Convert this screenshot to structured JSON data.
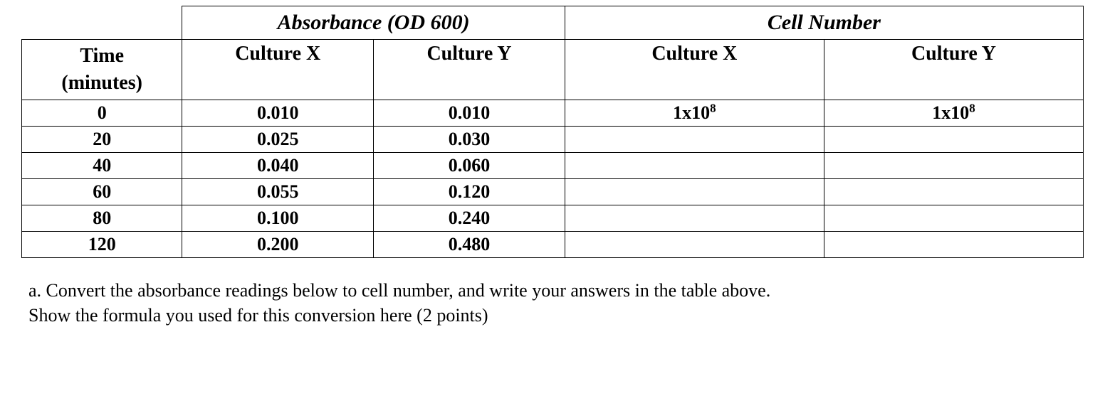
{
  "table": {
    "group_headers": {
      "absorbance": "Absorbance (OD 600)",
      "cell_number": "Cell Number"
    },
    "col_headers": {
      "time": "Time (minutes)",
      "abs_x": "Culture X",
      "abs_y": "Culture Y",
      "cell_x": "Culture X",
      "cell_y": "Culture Y"
    },
    "rows": [
      {
        "time": "0",
        "abs_x": "0.010",
        "abs_y": "0.010",
        "cell_x_base": "1x10",
        "cell_x_exp": "8",
        "cell_y_base": "1x10",
        "cell_y_exp": "8"
      },
      {
        "time": "20",
        "abs_x": "0.025",
        "abs_y": "0.030",
        "cell_x_base": "",
        "cell_x_exp": "",
        "cell_y_base": "",
        "cell_y_exp": ""
      },
      {
        "time": "40",
        "abs_x": "0.040",
        "abs_y": "0.060",
        "cell_x_base": "",
        "cell_x_exp": "",
        "cell_y_base": "",
        "cell_y_exp": ""
      },
      {
        "time": "60",
        "abs_x": "0.055",
        "abs_y": "0.120",
        "cell_x_base": "",
        "cell_x_exp": "",
        "cell_y_base": "",
        "cell_y_exp": ""
      },
      {
        "time": "80",
        "abs_x": "0.100",
        "abs_y": "0.240",
        "cell_x_base": "",
        "cell_x_exp": "",
        "cell_y_base": "",
        "cell_y_exp": ""
      },
      {
        "time": "120",
        "abs_x": "0.200",
        "abs_y": "0.480",
        "cell_x_base": "",
        "cell_x_exp": "",
        "cell_y_base": "",
        "cell_y_exp": ""
      }
    ]
  },
  "question": {
    "line1": "a.  Convert the absorbance readings below to cell number, and write your answers in the table above.",
    "line2": "Show the formula you used for this conversion here (2 points)"
  }
}
